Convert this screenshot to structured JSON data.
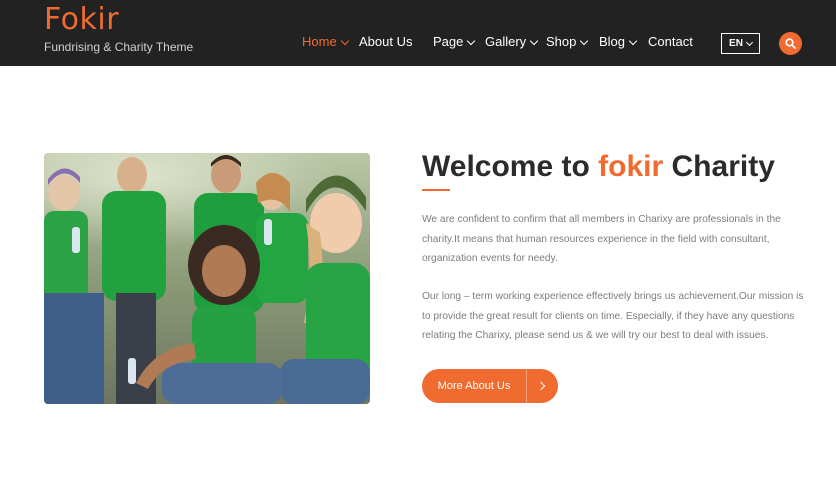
{
  "brand": {
    "name": "Fokir",
    "tagline": "Fundrising & Charity Theme",
    "accent_color": "#ef6b2f",
    "header_bg": "#222222"
  },
  "nav": {
    "items": [
      {
        "label": "Home",
        "dropdown": true,
        "active": true
      },
      {
        "label": "About Us",
        "dropdown": false,
        "active": false
      },
      {
        "label": "Page",
        "dropdown": true,
        "active": false
      },
      {
        "label": "Gallery",
        "dropdown": true,
        "active": false
      },
      {
        "label": "Shop",
        "dropdown": true,
        "active": false
      },
      {
        "label": "Blog",
        "dropdown": true,
        "active": false
      },
      {
        "label": "Contact",
        "dropdown": false,
        "active": false
      }
    ],
    "language": "EN",
    "search_icon": "search-icon"
  },
  "about": {
    "image_alt": "group of volunteers in green t-shirts",
    "heading_prefix": "Welcome to",
    "heading_accent": "fokir",
    "heading_suffix": "Charity",
    "paragraph1": "We are confident to confirm that all members in Charixy are professionals in the charity.It means that human resources experience in the field with consultant, organization events for needy.",
    "paragraph2": "Our long – term working experience effectively brings us achievement.Our mission is to provide the great result for clients on time. Especially, if they have any questions relating the Charixy, please send us & we will try our best to deal with issues.",
    "button_label": "More About Us",
    "button_icon": "chevron-right-icon"
  }
}
